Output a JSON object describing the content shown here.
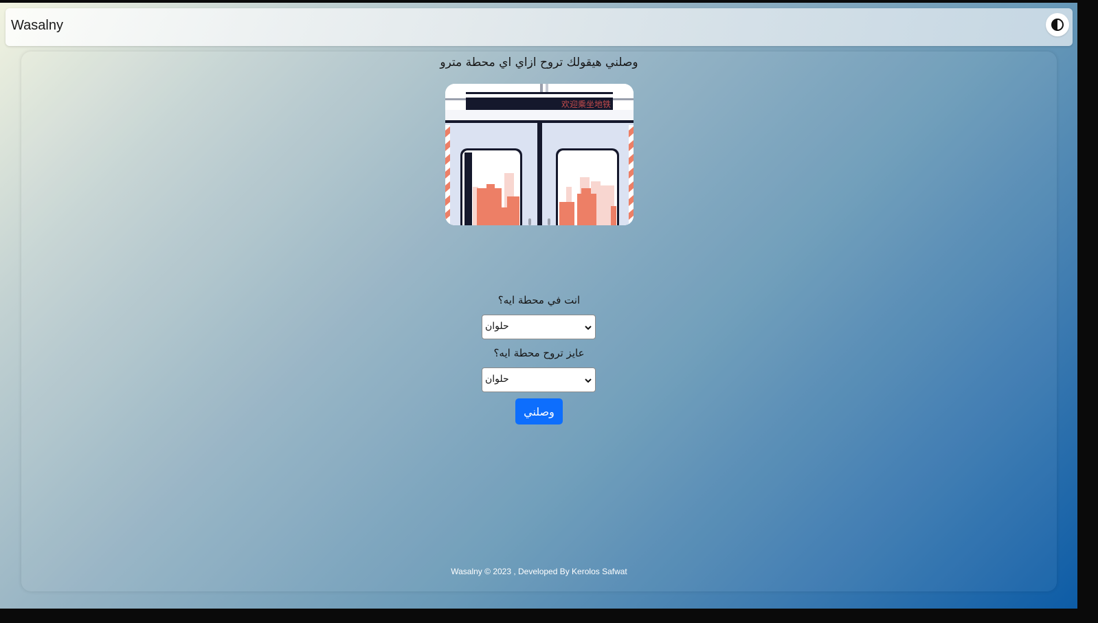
{
  "navbar": {
    "brand": "Wasalny",
    "theme_toggle_icon": "contrast-icon"
  },
  "main": {
    "headline": "وصلني هيقولك تروح ازاي اي محطة مترو",
    "illustration_sign_text": "欢迎乘坐地铁",
    "from_label": "انت في محطة ايه؟",
    "from_value": "حلوان",
    "to_label": "عايز تروح محطة ايه؟",
    "to_value": "حلوان",
    "submit_label": "وصلني"
  },
  "footer": {
    "text": "Wasalny © 2023 , Developed By Kerolos Safwat"
  },
  "colors": {
    "primary_button": "#0d6efd",
    "illustration_building": "#ed7f66",
    "illustration_building_light": "#f8d6d0",
    "illustration_panel": "#dbe2f2",
    "illustration_dark": "#15182c"
  }
}
